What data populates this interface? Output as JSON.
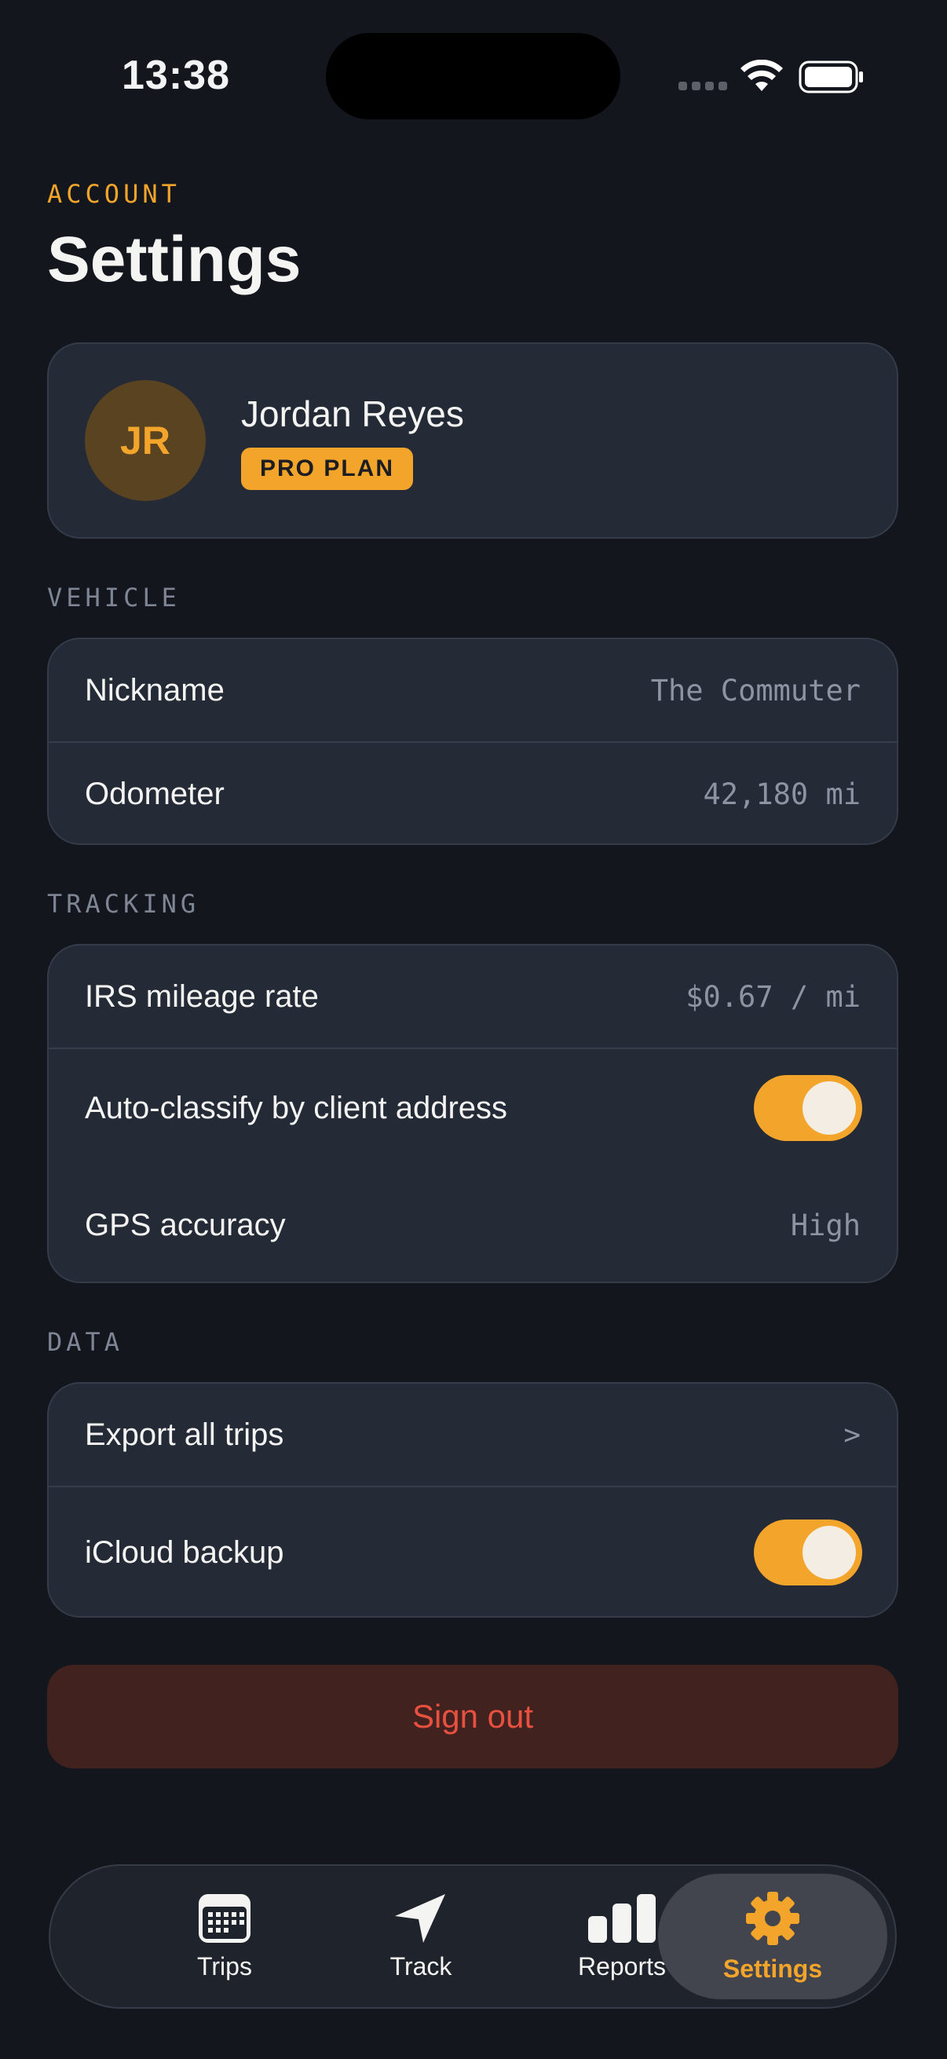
{
  "status_bar": {
    "time": "13:38"
  },
  "header": {
    "section": "ACCOUNT",
    "title": "Settings"
  },
  "profile": {
    "initials": "JR",
    "name": "Jordan Reyes",
    "plan": "PRO PLAN"
  },
  "vehicle": {
    "section": "VEHICLE",
    "rows": [
      {
        "label": "Nickname",
        "value": "The Commuter"
      },
      {
        "label": "Odometer",
        "value": "42,180 mi"
      }
    ]
  },
  "tracking": {
    "section": "TRACKING",
    "mileage_rate": {
      "label": "IRS mileage rate",
      "value": "$0.67 / mi"
    },
    "auto_classify": {
      "label": "Auto-classify by client address",
      "enabled": true
    },
    "gps": {
      "label": "GPS accuracy",
      "value": "High"
    }
  },
  "data_section": {
    "section": "DATA",
    "export": {
      "label": "Export all trips",
      "chevron": ">"
    },
    "icloud": {
      "label": "iCloud backup",
      "enabled": true
    }
  },
  "signout": {
    "label": "Sign out"
  },
  "tabbar": {
    "tabs": [
      {
        "label": "Trips",
        "icon": "calendar-icon"
      },
      {
        "label": "Track",
        "icon": "navigation-arrow-icon"
      },
      {
        "label": "Reports",
        "icon": "bar-chart-icon"
      },
      {
        "label": "Settings",
        "icon": "gear-icon",
        "active": true
      }
    ]
  },
  "colors": {
    "accent": "#f2a52a",
    "danger": "#e8503f",
    "background": "#13161c",
    "card": "#242a36"
  }
}
